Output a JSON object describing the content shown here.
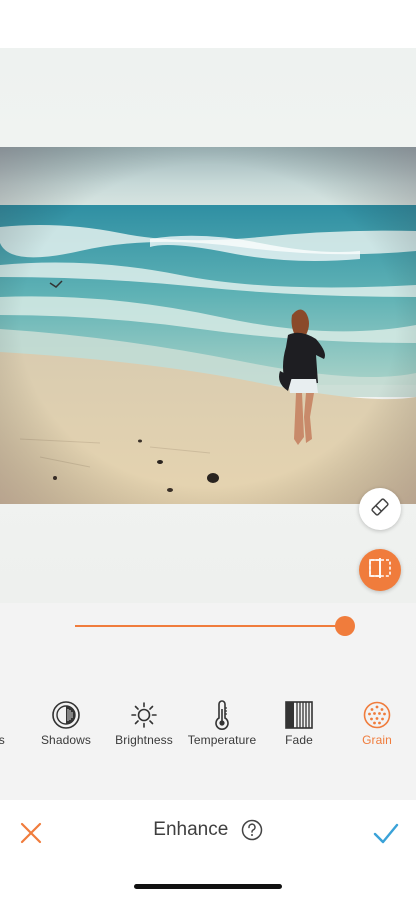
{
  "editor": {
    "title": "Enhance",
    "slider_value": 1.0
  },
  "tools": [
    {
      "label": "Highlights",
      "icon": "highlights-icon",
      "active": false
    },
    {
      "label": "Shadows",
      "icon": "shadows-icon",
      "active": false
    },
    {
      "label": "Brightness",
      "icon": "brightness-icon",
      "active": false
    },
    {
      "label": "Temperature",
      "icon": "temperature-icon",
      "active": false
    },
    {
      "label": "Fade",
      "icon": "fade-icon",
      "active": false
    },
    {
      "label": "Grain",
      "icon": "grain-icon",
      "active": true
    }
  ],
  "actions": {
    "cancel_icon": "close-icon",
    "confirm_icon": "checkmark-icon",
    "help_icon": "question-circle-icon",
    "eraser_icon": "eraser-icon",
    "compare_icon": "compare-icon"
  },
  "colors": {
    "accent": "#f07c3c",
    "confirm": "#3aa2d8",
    "text": "#3a3a3a"
  }
}
